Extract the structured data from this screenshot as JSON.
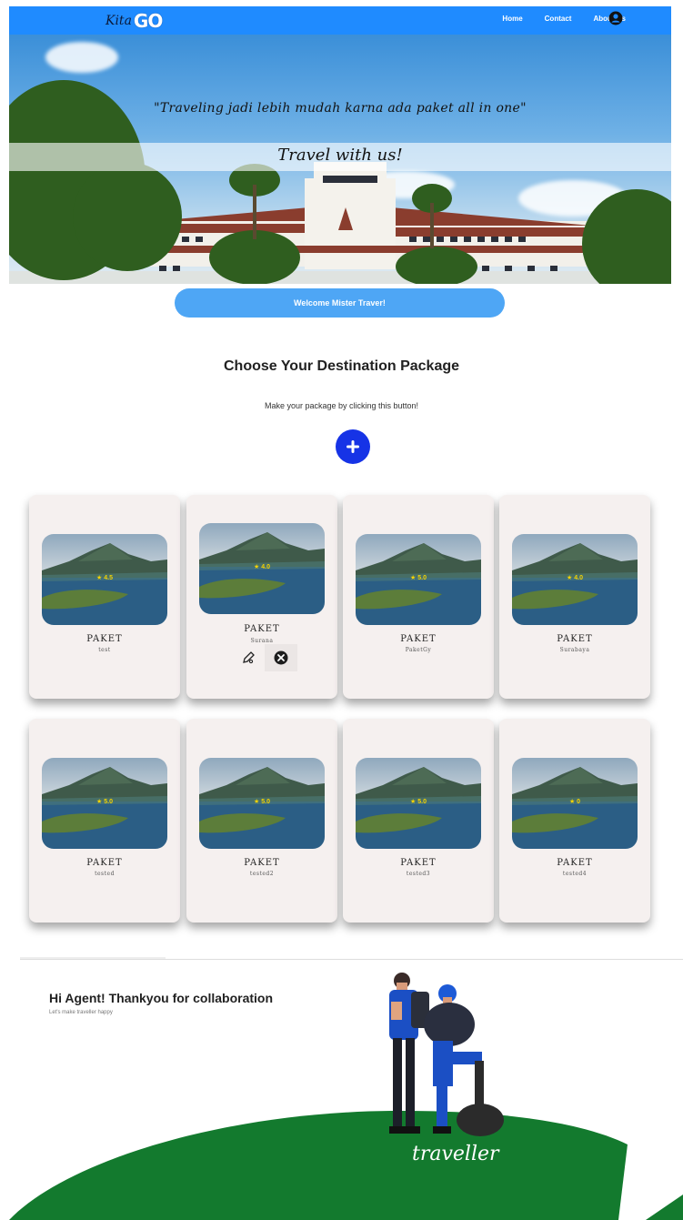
{
  "nav": {
    "logo_script": "Kita",
    "logo_go": "GO",
    "links": [
      "Home",
      "Contact",
      "About Us"
    ],
    "profile_icon": "user-circle-icon",
    "bg_color": "#1f8bff"
  },
  "hero": {
    "quote": "\"Traveling jadi lebih mudah karna ada paket all in one\"",
    "tagline": "Travel with us!"
  },
  "welcome": {
    "label": "Welcome Mister Traver!",
    "color": "#4ea6f5"
  },
  "section": {
    "title": "Choose Your Destination Package",
    "subtitle": "Make your package by clicking this button!",
    "add_icon": "plus-icon",
    "add_color": "#1633e6"
  },
  "packages": [
    {
      "title": "PAKET",
      "name": "test",
      "rating": "★ 4.5"
    },
    {
      "title": "PAKET",
      "name": "Surana",
      "rating": "★ 4.0",
      "actions": [
        "edit-icon",
        "close-circle-icon"
      ]
    },
    {
      "title": "PAKET",
      "name": "PaketGy",
      "rating": "★ 5.0"
    },
    {
      "title": "PAKET",
      "name": "Surabaya",
      "rating": "★ 4.0"
    },
    {
      "title": "PAKET",
      "name": "tested",
      "rating": "★ 5.0"
    },
    {
      "title": "PAKET",
      "name": "tested2",
      "rating": "★ 5.0"
    },
    {
      "title": "PAKET",
      "name": "tested3",
      "rating": "★ 5.0"
    },
    {
      "title": "PAKET",
      "name": "tested4",
      "rating": "★ 0"
    }
  ],
  "footer": {
    "title": "Hi Agent! Thankyou for collaboration",
    "subtitle": "Let's make traveller happy",
    "illustration_label": "traveller",
    "hill_color": "#137a2e"
  }
}
